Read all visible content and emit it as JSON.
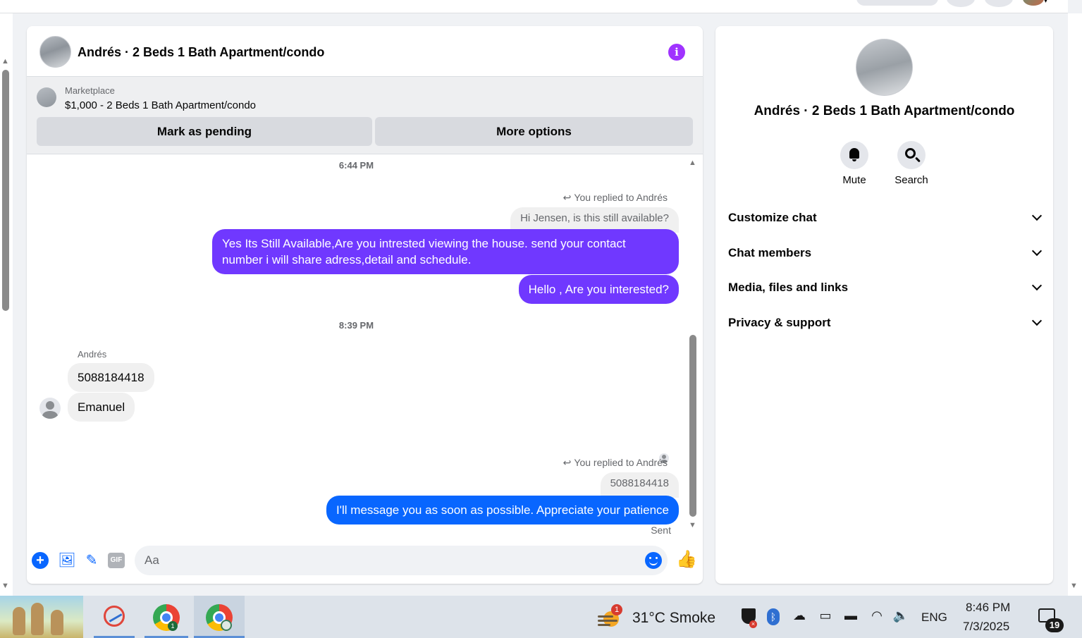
{
  "chat": {
    "title": "Andrés · 2 Beds 1 Bath Apartment/condo",
    "marketplace": {
      "label": "Marketplace",
      "listing": "$1,000 - 2 Beds 1 Bath Apartment/condo",
      "mark_pending": "Mark as pending",
      "more_options": "More options"
    },
    "messages": {
      "time1": "6:44 PM",
      "replied1": "You replied to Andrés",
      "quoted1": "Hi Jensen, is this still available?",
      "out1": "Yes Its Still Available,Are you intrested viewing the house. send your contact number i will share adress,detail and schedule.",
      "out2": "Hello , Are you interested?",
      "time2": "8:39 PM",
      "sender": "Andrés",
      "in1": "5088184418",
      "in2": "Emanuel",
      "replied2": "You replied to Andrés",
      "quoted2": "5088184418",
      "out3": "I'll message you as soon as possible. Appreciate your patience",
      "status": "Sent"
    },
    "composer": {
      "placeholder": "Aa",
      "gif_label": "GIF"
    },
    "colors": {
      "accent_purple": "#7038ff",
      "accent_blue": "#0866ff",
      "info_icon": "#a033ff"
    }
  },
  "sidebar": {
    "title": "Andrés · 2 Beds 1 Bath Apartment/condo",
    "actions": {
      "mute": "Mute",
      "search": "Search"
    },
    "sections": [
      "Customize chat",
      "Chat members",
      "Media, files and links",
      "Privacy & support"
    ]
  },
  "taskbar": {
    "weather_badge": "1",
    "weather": "31°C  Smoke",
    "language": "ENG",
    "time": "8:46 PM",
    "date": "7/3/2025",
    "notifications": "19",
    "chrome_badge": "1"
  }
}
